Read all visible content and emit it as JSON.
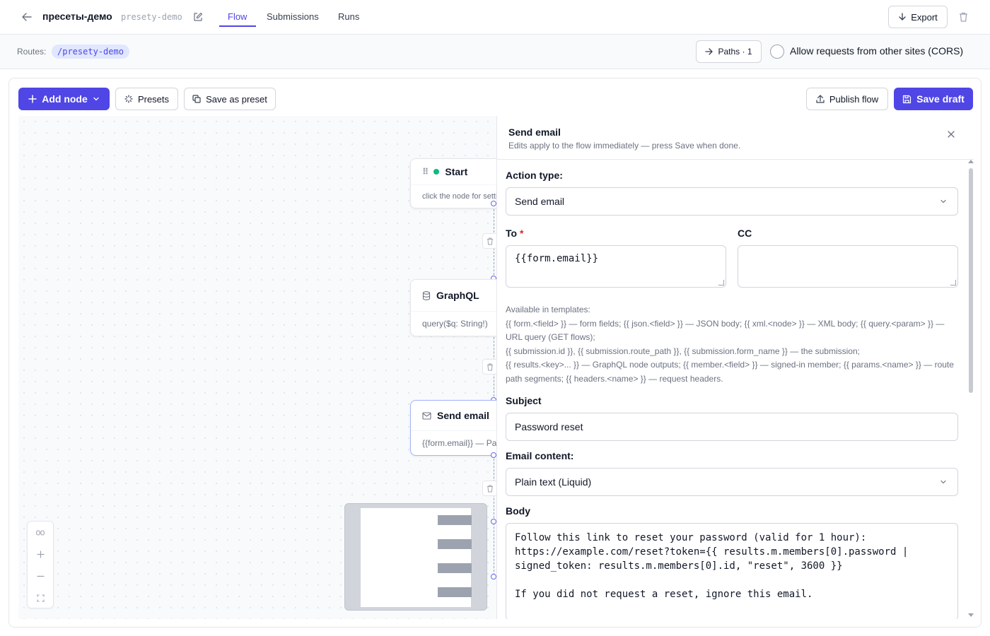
{
  "header": {
    "title": "пресеты-демо",
    "slug": "presety-demo",
    "tabs": [
      {
        "label": "Flow",
        "active": true
      },
      {
        "label": "Submissions",
        "active": false
      },
      {
        "label": "Runs",
        "active": false
      }
    ],
    "export_label": "Export"
  },
  "routes": {
    "label": "Routes:",
    "route": "/presety-demo",
    "paths_label": "Paths · 1",
    "cors_label": "Allow requests from other sites (CORS)",
    "cors_checked": false
  },
  "toolbar": {
    "add_node_label": "Add node",
    "presets_label": "Presets",
    "save_as_preset_label": "Save as preset",
    "publish_label": "Publish flow",
    "save_draft_label": "Save draft"
  },
  "nodes": [
    {
      "title": "Start",
      "subtitle": "click the node for settings"
    },
    {
      "title": "GraphQL",
      "subtitle": "query($q: String!)"
    },
    {
      "title": "Send email",
      "subtitle": "{{form.email}} — Password reset",
      "selected": true
    }
  ],
  "panel": {
    "title": "Send email",
    "description": "Edits apply to the flow immediately — press Save when done.",
    "action_type_label": "Action type:",
    "action_type_value": "Send email",
    "to_label": "To",
    "to_value": "{{form.email}}",
    "cc_label": "CC",
    "cc_value": "",
    "help_text": "Available in templates:\n{{ form.<field> }} — form fields; {{ json.<field> }} — JSON body; {{ xml.<node> }} — XML body; {{ query.<param> }} — URL query (GET flows);\n{{ submission.id }}, {{ submission.route_path }}, {{ submission.form_name }} — the submission;\n{{ results.<key>... }} — GraphQL node outputs; {{ member.<field> }} — signed-in member; {{ params.<name> }} — route path segments; {{ headers.<name> }} — request headers.",
    "subject_label": "Subject",
    "subject_value": "Password reset",
    "content_label": "Email content:",
    "content_value": "Plain text (Liquid)",
    "body_label": "Body",
    "body_value": "Follow this link to reset your password (valid for 1 hour):\nhttps://example.com/reset?token={{ results.m.members[0].password | signed_token: results.m.members[0].id, \"reset\", 3600 }}\n\nIf you did not request a reset, ignore this email."
  },
  "colors": {
    "accent": "#4f46e5",
    "start_dot": "#10b981"
  }
}
